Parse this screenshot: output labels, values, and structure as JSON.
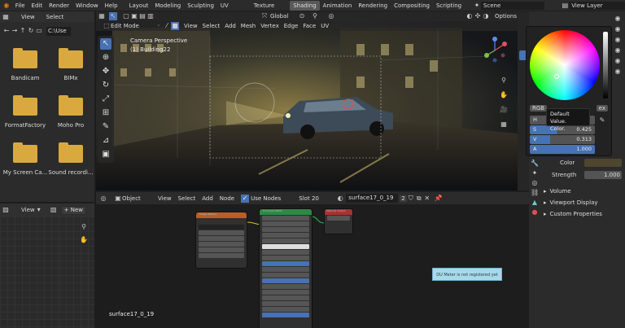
{
  "topbar": {
    "menus": [
      "File",
      "Edit",
      "Render",
      "Window",
      "Help"
    ],
    "workspaces": [
      "Layout",
      "Modeling",
      "Sculpting",
      "UV Editing",
      "Texture Paint",
      "Shading",
      "Animation",
      "Rendering",
      "Compositing",
      "Scripting"
    ],
    "active_workspace": "Shading",
    "scene": "Scene",
    "view_layer": "View Layer"
  },
  "filebrowser": {
    "menus": [
      "View",
      "Select"
    ],
    "path": "C:\\Use",
    "items": [
      {
        "label": "Bandicam"
      },
      {
        "label": "BIMx"
      },
      {
        "label": "FormatFactory"
      },
      {
        "label": "Moho Pro"
      },
      {
        "label": "My Screen Ca..."
      },
      {
        "label": "Sound recordi..."
      }
    ]
  },
  "imageeditor": {
    "view": "View",
    "new": "New"
  },
  "viewport": {
    "mode": "Edit Mode",
    "menus": [
      "View",
      "Select",
      "Add",
      "Mesh",
      "Vertex",
      "Edge",
      "Face",
      "UV"
    ],
    "transform": "Global",
    "options": "Options",
    "camera_text": "Camera Perspective",
    "object_text": "(1) Building22"
  },
  "nodeeditor": {
    "type": "Object",
    "menus": [
      "View",
      "Select",
      "Add",
      "Node"
    ],
    "use_nodes": "Use Nodes",
    "slot": "Slot 20",
    "material": "surface17_0_19",
    "users": "2",
    "footer": "surface17_0_19",
    "overlay_msg": "DU Meter is not registered yet"
  },
  "colorpicker": {
    "mode": "RGB",
    "hex": "ex",
    "tooltip_line1": "Default Value.",
    "tooltip_line2": "Color.",
    "H_label": "H",
    "S_label": "S",
    "S_value": "0.425",
    "V_label": "V",
    "V_value": "0.313",
    "A_label": "A",
    "A_value": "1.000"
  },
  "properties": {
    "color_label": "Color",
    "strength_label": "Strength",
    "strength_value": "1.000",
    "sections": [
      "Volume",
      "Viewport Display",
      "Custom Properties"
    ]
  },
  "nodes": {
    "image_title": "Image Texture",
    "bsdf_title": "Principled BSDF",
    "output_title": "Material Output"
  },
  "colors": {
    "header": "#2b2b2b",
    "active_ws": "#595959",
    "accent": "#4772b3",
    "tooltip": "#161616",
    "msg_bg": "#a8d8ea"
  }
}
